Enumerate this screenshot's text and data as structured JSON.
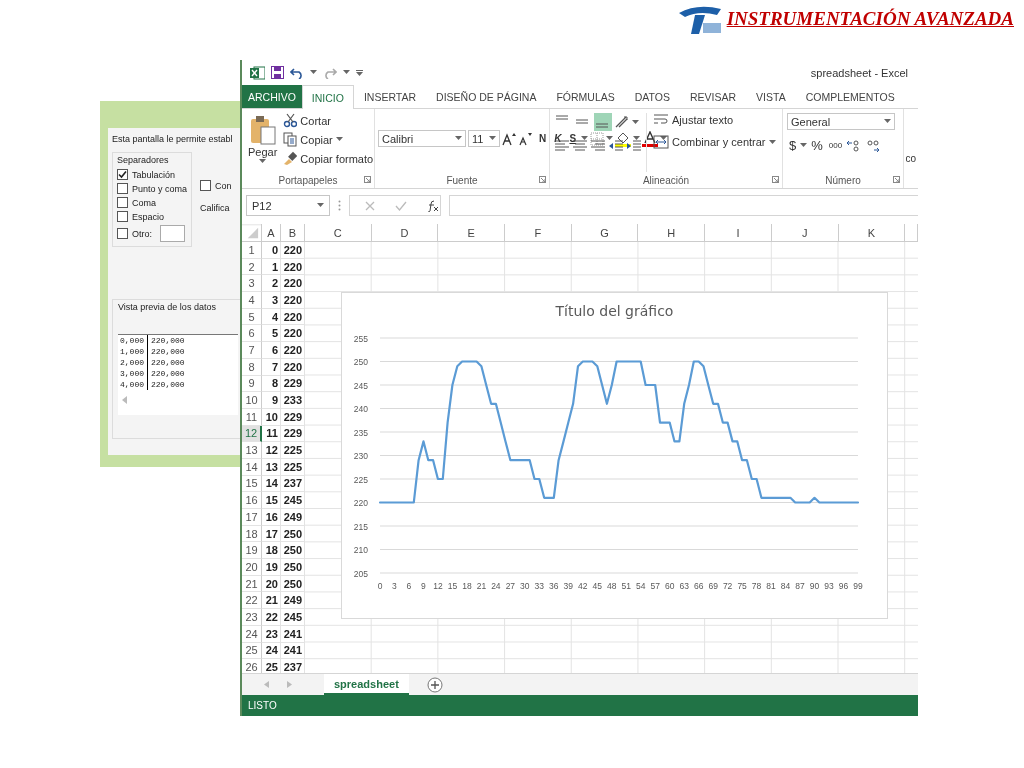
{
  "slide": {
    "title": "INSTRUMENTACIÓN AVANZADA"
  },
  "dialog": {
    "intro": "Esta pantalla le permite establ",
    "separators_title": "Separadores",
    "separators": [
      {
        "label": "Tabulación",
        "checked": true,
        "kind": "plain"
      },
      {
        "label": "Punto y coma",
        "checked": false,
        "kind": "plain"
      },
      {
        "label": "Coma",
        "checked": false,
        "kind": "plain"
      },
      {
        "label": "Espacio",
        "checked": false,
        "kind": "plain"
      },
      {
        "label": "Otro:",
        "checked": false,
        "kind": "with_field"
      }
    ],
    "consecutive": {
      "label": "Con",
      "checked": false
    },
    "qualifier_label": "Califica",
    "preview_title": "Vista previa de los datos",
    "preview_rows": [
      [
        "0,000",
        "220,000"
      ],
      [
        "1,000",
        "220,000"
      ],
      [
        "2,000",
        "220,000"
      ],
      [
        "3,000",
        "220,000"
      ],
      [
        "4,000",
        "220,000"
      ]
    ]
  },
  "excel": {
    "title": "spreadsheet - Excel",
    "tabs": [
      {
        "label": "ARCHIVO",
        "kind": "file",
        "selected": false
      },
      {
        "label": "INICIO",
        "kind": "tab",
        "selected": true
      },
      {
        "label": "INSERTAR",
        "kind": "tab",
        "selected": false
      },
      {
        "label": "DISEÑO DE PÁGINA",
        "kind": "tab",
        "selected": false
      },
      {
        "label": "FÓRMULAS",
        "kind": "tab",
        "selected": false
      },
      {
        "label": "DATOS",
        "kind": "tab",
        "selected": false
      },
      {
        "label": "REVISAR",
        "kind": "tab",
        "selected": false
      },
      {
        "label": "VISTA",
        "kind": "tab",
        "selected": false
      },
      {
        "label": "COMPLEMENTOS",
        "kind": "tab",
        "selected": false
      }
    ],
    "ribbon": {
      "groups": [
        {
          "kind": "clipboard",
          "label": "Portapapeles",
          "paste": "Pegar",
          "items": [
            "Cortar",
            "Copiar",
            "Copiar formato"
          ]
        },
        {
          "kind": "font",
          "label": "Fuente",
          "font": "Calibri",
          "size": "11",
          "styles": [
            "N",
            "K",
            "S"
          ]
        },
        {
          "kind": "alignment",
          "label": "Alineación",
          "wrap": "Ajustar texto",
          "merge": "Combinar y centrar",
          "vertical_align": [
            {
              "selected": false
            },
            {
              "selected": false
            },
            {
              "selected": true
            }
          ]
        },
        {
          "kind": "number",
          "label": "Número",
          "format": "General",
          "symbols": [
            "$",
            "%",
            "000"
          ]
        }
      ],
      "partial_text": "co"
    },
    "name_box": "P12",
    "columns": [
      "A",
      "B",
      "C",
      "D",
      "E",
      "F",
      "G",
      "H",
      "I",
      "J",
      "K"
    ],
    "rows": [
      {
        "header": "1",
        "a": "0",
        "b": "220",
        "selected": false
      },
      {
        "header": "2",
        "a": "1",
        "b": "220",
        "selected": false
      },
      {
        "header": "3",
        "a": "2",
        "b": "220",
        "selected": false
      },
      {
        "header": "4",
        "a": "3",
        "b": "220",
        "selected": false
      },
      {
        "header": "5",
        "a": "4",
        "b": "220",
        "selected": false
      },
      {
        "header": "6",
        "a": "5",
        "b": "220",
        "selected": false
      },
      {
        "header": "7",
        "a": "6",
        "b": "220",
        "selected": false
      },
      {
        "header": "8",
        "a": "7",
        "b": "220",
        "selected": false
      },
      {
        "header": "9",
        "a": "8",
        "b": "229",
        "selected": false
      },
      {
        "header": "10",
        "a": "9",
        "b": "233",
        "selected": false
      },
      {
        "header": "11",
        "a": "10",
        "b": "229",
        "selected": false
      },
      {
        "header": "12",
        "a": "11",
        "b": "229",
        "selected": true
      },
      {
        "header": "13",
        "a": "12",
        "b": "225",
        "selected": false
      },
      {
        "header": "14",
        "a": "13",
        "b": "225",
        "selected": false
      },
      {
        "header": "15",
        "a": "14",
        "b": "237",
        "selected": false
      },
      {
        "header": "16",
        "a": "15",
        "b": "245",
        "selected": false
      },
      {
        "header": "17",
        "a": "16",
        "b": "249",
        "selected": false
      },
      {
        "header": "18",
        "a": "17",
        "b": "250",
        "selected": false
      },
      {
        "header": "19",
        "a": "18",
        "b": "250",
        "selected": false
      },
      {
        "header": "20",
        "a": "19",
        "b": "250",
        "selected": false
      },
      {
        "header": "21",
        "a": "20",
        "b": "250",
        "selected": false
      },
      {
        "header": "22",
        "a": "21",
        "b": "249",
        "selected": false
      },
      {
        "header": "23",
        "a": "22",
        "b": "245",
        "selected": false
      },
      {
        "header": "24",
        "a": "23",
        "b": "241",
        "selected": false
      },
      {
        "header": "25",
        "a": "24",
        "b": "241",
        "selected": false
      },
      {
        "header": "26",
        "a": "25",
        "b": "237",
        "selected": false
      }
    ],
    "chart_data": {
      "type": "line",
      "title": "Título del gráfico",
      "grid": true,
      "x": [
        0,
        1,
        2,
        3,
        4,
        5,
        6,
        7,
        8,
        9,
        10,
        11,
        12,
        13,
        14,
        15,
        16,
        17,
        18,
        19,
        20,
        21,
        22,
        23,
        24,
        25,
        26,
        27,
        28,
        29,
        30,
        31,
        32,
        33,
        34,
        35,
        36,
        37,
        38,
        39,
        40,
        41,
        42,
        43,
        44,
        45,
        46,
        47,
        48,
        49,
        50,
        51,
        52,
        53,
        54,
        55,
        56,
        57,
        58,
        59,
        60,
        61,
        62,
        63,
        64,
        65,
        66,
        67,
        68,
        69,
        70,
        71,
        72,
        73,
        74,
        75,
        76,
        77,
        78,
        79,
        80,
        81,
        82,
        83,
        84,
        85,
        86,
        87,
        88,
        89,
        90,
        91,
        92,
        93,
        94,
        95,
        96,
        97,
        98,
        99
      ],
      "series": [
        {
          "color": "#5b9bd5",
          "values": [
            220,
            220,
            220,
            220,
            220,
            220,
            220,
            220,
            229,
            233,
            229,
            229,
            225,
            225,
            237,
            245,
            249,
            250,
            250,
            250,
            250,
            249,
            245,
            241,
            241,
            237,
            233,
            229,
            229,
            229,
            229,
            229,
            225,
            225,
            221,
            221,
            221,
            229,
            233,
            237,
            241,
            249,
            250,
            250,
            250,
            249,
            245,
            241,
            245,
            250,
            250,
            250,
            250,
            250,
            250,
            245,
            245,
            245,
            237,
            237,
            237,
            233,
            233,
            241,
            245,
            250,
            250,
            249,
            245,
            241,
            241,
            237,
            237,
            233,
            233,
            229,
            229,
            225,
            225,
            221,
            221,
            221,
            221,
            221,
            221,
            221,
            220,
            220,
            220,
            220,
            221,
            220,
            220,
            220,
            220,
            220,
            220,
            220,
            220,
            220
          ]
        }
      ],
      "xlim": [
        0,
        99
      ],
      "xticks": [
        0,
        3,
        6,
        9,
        12,
        15,
        18,
        21,
        24,
        27,
        30,
        33,
        36,
        39,
        42,
        45,
        48,
        51,
        54,
        57,
        60,
        63,
        66,
        69,
        72,
        75,
        78,
        81,
        84,
        87,
        90,
        93,
        96,
        99
      ],
      "yticks": [
        205,
        210,
        215,
        220,
        225,
        230,
        235,
        240,
        245,
        250,
        255
      ],
      "ylim": [
        205,
        255
      ]
    },
    "sheet_tabs": [
      {
        "label": "spreadsheet",
        "selected": true
      }
    ],
    "status": "LISTO"
  }
}
